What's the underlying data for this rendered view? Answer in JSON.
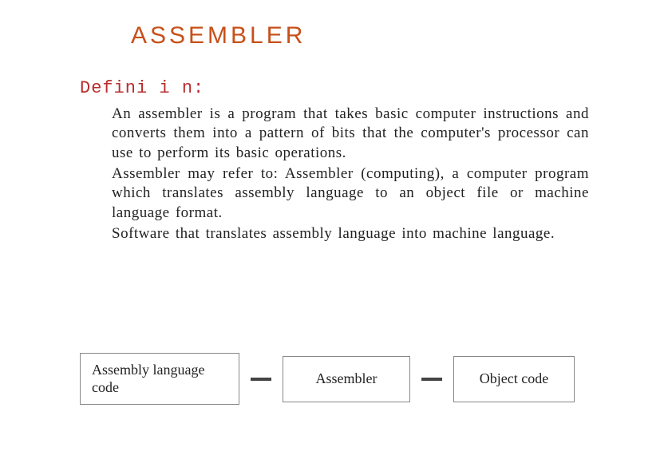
{
  "title": "ASSEMBLER",
  "definition_label": "Defini i n:",
  "paragraphs": {
    "p1": "An assembler is a program that takes basic computer instructions and converts them into a pattern of bits that the computer's processor can use to perform its basic operations.",
    "p2": "Assembler may refer to: Assembler (computing), a computer program which translates assembly language to an object file or machine language format.",
    "p3": "Software that translates assembly language into machine language."
  },
  "diagram": {
    "box1": "Assembly language code",
    "box2": "Assembler",
    "box3": "Object code"
  }
}
